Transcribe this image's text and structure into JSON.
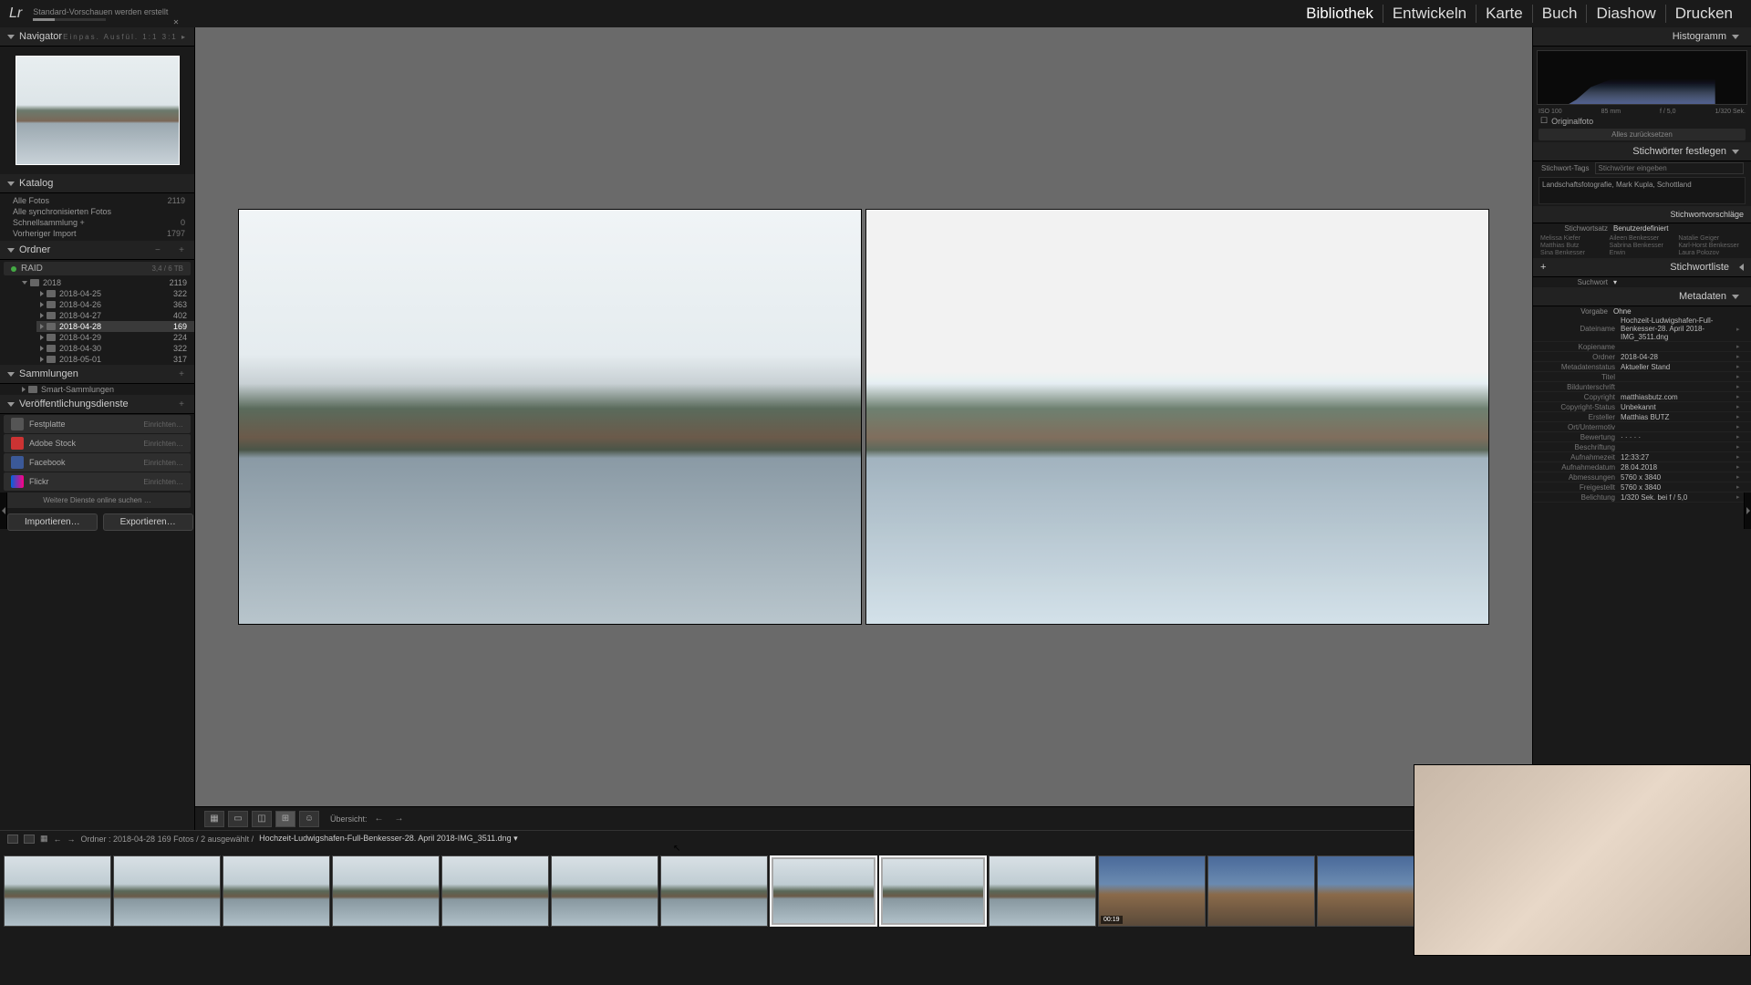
{
  "app": {
    "logo": "Lr",
    "status": "Standard-Vorschauen werden erstellt"
  },
  "topnav": {
    "items": [
      "Bibliothek",
      "Entwickeln",
      "Karte",
      "Buch",
      "Diashow",
      "Drucken"
    ],
    "active": 0
  },
  "navigator": {
    "title": "Navigator",
    "modes": "Einpas.   Ausfül.   1:1   3:1  ▸"
  },
  "catalog": {
    "title": "Katalog",
    "rows": [
      {
        "label": "Alle Fotos",
        "count": "2119"
      },
      {
        "label": "Alle synchronisierten Fotos",
        "count": ""
      },
      {
        "label": "Schnellsammlung  +",
        "count": "0"
      },
      {
        "label": "Vorheriger Import",
        "count": "1797"
      }
    ]
  },
  "folders": {
    "title": "Ordner",
    "volume": {
      "name": "RAID",
      "info": "3,4 / 6 TB"
    },
    "root": {
      "name": "2018",
      "count": "2119"
    },
    "items": [
      {
        "name": "2018-04-25",
        "count": "322"
      },
      {
        "name": "2018-04-26",
        "count": "363"
      },
      {
        "name": "2018-04-27",
        "count": "402"
      },
      {
        "name": "2018-04-28",
        "count": "169",
        "selected": true
      },
      {
        "name": "2018-04-29",
        "count": "224"
      },
      {
        "name": "2018-04-30",
        "count": "322"
      },
      {
        "name": "2018-05-01",
        "count": "317"
      }
    ]
  },
  "collections": {
    "title": "Sammlungen",
    "smart": "Smart-Sammlungen"
  },
  "publish": {
    "title": "Veröffentlichungsdienste",
    "items": [
      {
        "name": "Festplatte",
        "action": "Einrichten…",
        "color": "#555"
      },
      {
        "name": "Adobe Stock",
        "action": "Einrichten…",
        "color": "#c33"
      },
      {
        "name": "Facebook",
        "action": "Einrichten…",
        "color": "#3b5998"
      },
      {
        "name": "Flickr",
        "action": "Einrichten…",
        "color": "#ff0084"
      }
    ],
    "more": "Weitere Dienste online suchen …"
  },
  "buttons": {
    "import": "Importieren…",
    "export": "Exportieren…"
  },
  "centerToolbar": {
    "label": "Übersicht:"
  },
  "filmstripInfo": {
    "path": "Ordner : 2018-04-28   169 Fotos /  2 ausgewählt /",
    "file": "Hochzeit-Ludwigshafen-Full-Benkesser-28. April 2018-IMG_3511.dng  ▾"
  },
  "histogram": {
    "title": "Histogramm",
    "iso": "ISO 100",
    "focal": "85 mm",
    "aperture": "f / 5,0",
    "shutter": "1/320 Sek.",
    "original": "Originalfoto",
    "reset": "Alles zurücksetzen"
  },
  "keywords": {
    "title": "Stichwörter festlegen",
    "tagsLabel": "Stichwort-Tags",
    "tagsPlaceholder": "Stichwörter eingeben",
    "tagsValue": "Landschaftsfotografie, Mark Kupla, Schottland",
    "suggTitle": "Stichwortvorschläge",
    "setLabel": "Stichwortsatz",
    "setValue": "Benutzerdefiniert",
    "sugg": [
      "Melissa Kiefer",
      "Aileen Benkesser",
      "Natalie Geiger",
      "Matthias Butz",
      "Sabrina Benkesser",
      "Karl-Horst Benkesser",
      "Sina Benkesser",
      "Erwin",
      "Laura Polozov"
    ],
    "listTitle": "Stichwortliste",
    "listLabel": "Suchwort"
  },
  "metadata": {
    "title": "Metadaten",
    "presetLabel": "Vorgabe",
    "presetValue": "Ohne",
    "rows": [
      {
        "k": "Dateiname",
        "v": "Hochzeit-Ludwigshafen-Full-Benkesser-28. April 2018-IMG_3511.dng"
      },
      {
        "k": "Kopiename",
        "v": ""
      },
      {
        "k": "Ordner",
        "v": "2018-04-28"
      },
      {
        "k": "Metadatenstatus",
        "v": "Aktueller Stand"
      },
      {
        "k": "Titel",
        "v": ""
      },
      {
        "k": "Bildunterschrift",
        "v": ""
      },
      {
        "k": "Copyright",
        "v": "matthiasbutz.com"
      },
      {
        "k": "Copyright-Status",
        "v": "Unbekannt"
      },
      {
        "k": "Ersteller",
        "v": "Matthias BUTZ"
      },
      {
        "k": "Ort/Untermotiv",
        "v": ""
      },
      {
        "k": "Bewertung",
        "v": "·  ·  ·  ·  ·"
      },
      {
        "k": "Beschriftung",
        "v": ""
      },
      {
        "k": "Aufnahmezeit",
        "v": "12:33:27"
      },
      {
        "k": "Aufnahmedatum",
        "v": "28.04.2018"
      },
      {
        "k": "Abmessungen",
        "v": "5760 x 3840"
      },
      {
        "k": "Freigestellt",
        "v": "5760 x 3840"
      },
      {
        "k": "Belichtung",
        "v": "1/320 Sek. bei f / 5,0"
      }
    ]
  },
  "thumbs": {
    "videoBadge": "00:19"
  }
}
